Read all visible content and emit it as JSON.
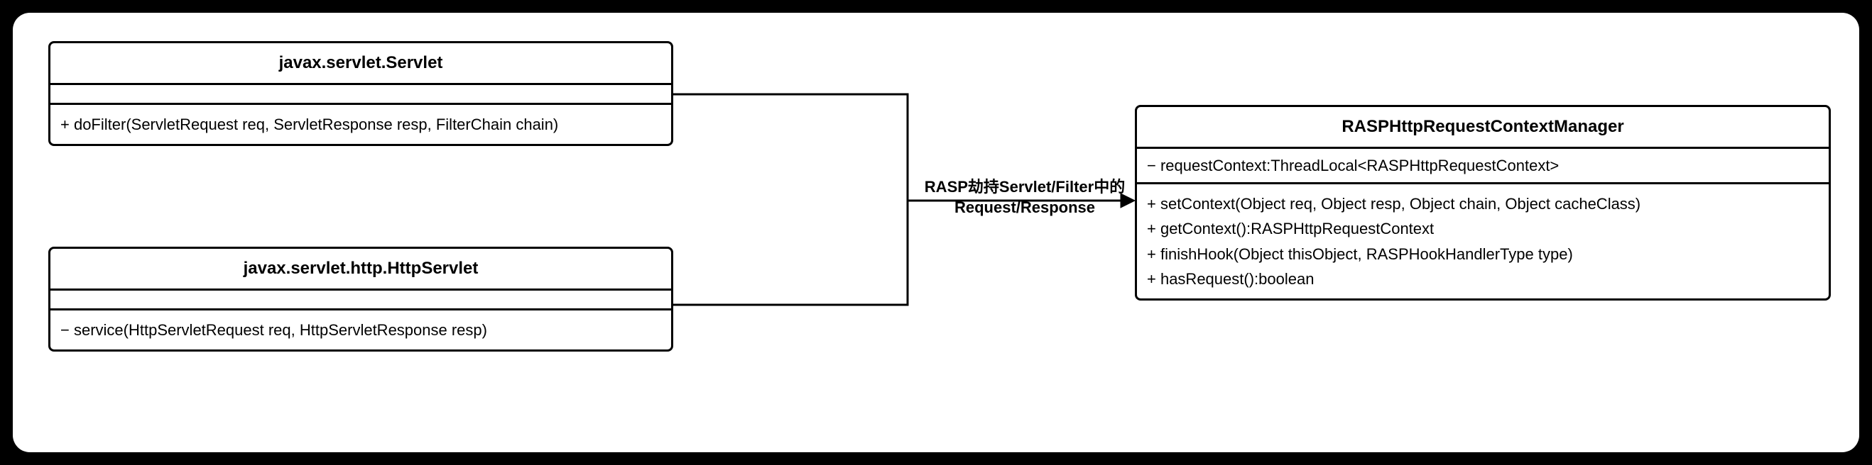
{
  "classes": {
    "servlet": {
      "name": "javax.servlet.Servlet",
      "attributes": [],
      "operations": [
        "+ doFilter(ServletRequest req, ServletResponse resp, FilterChain chain)"
      ]
    },
    "httpservlet": {
      "name": "javax.servlet.http.HttpServlet",
      "attributes": [],
      "operations": [
        "− service(HttpServletRequest req, HttpServletResponse resp)"
      ]
    },
    "rasp": {
      "name": "RASPHttpRequestContextManager",
      "attributes": [
        "− requestContext:ThreadLocal<RASPHttpRequestContext>"
      ],
      "operations": [
        "+ setContext(Object req, Object resp, Object chain, Object cacheClass)",
        "+ getContext():RASPHttpRequestContext",
        "+ finishHook(Object thisObject, RASPHookHandlerType type)",
        "+ hasRequest():boolean"
      ]
    }
  },
  "edge_label": {
    "line1": "RASP劫持Servlet/Filter中的",
    "line2": "Request/Response"
  }
}
